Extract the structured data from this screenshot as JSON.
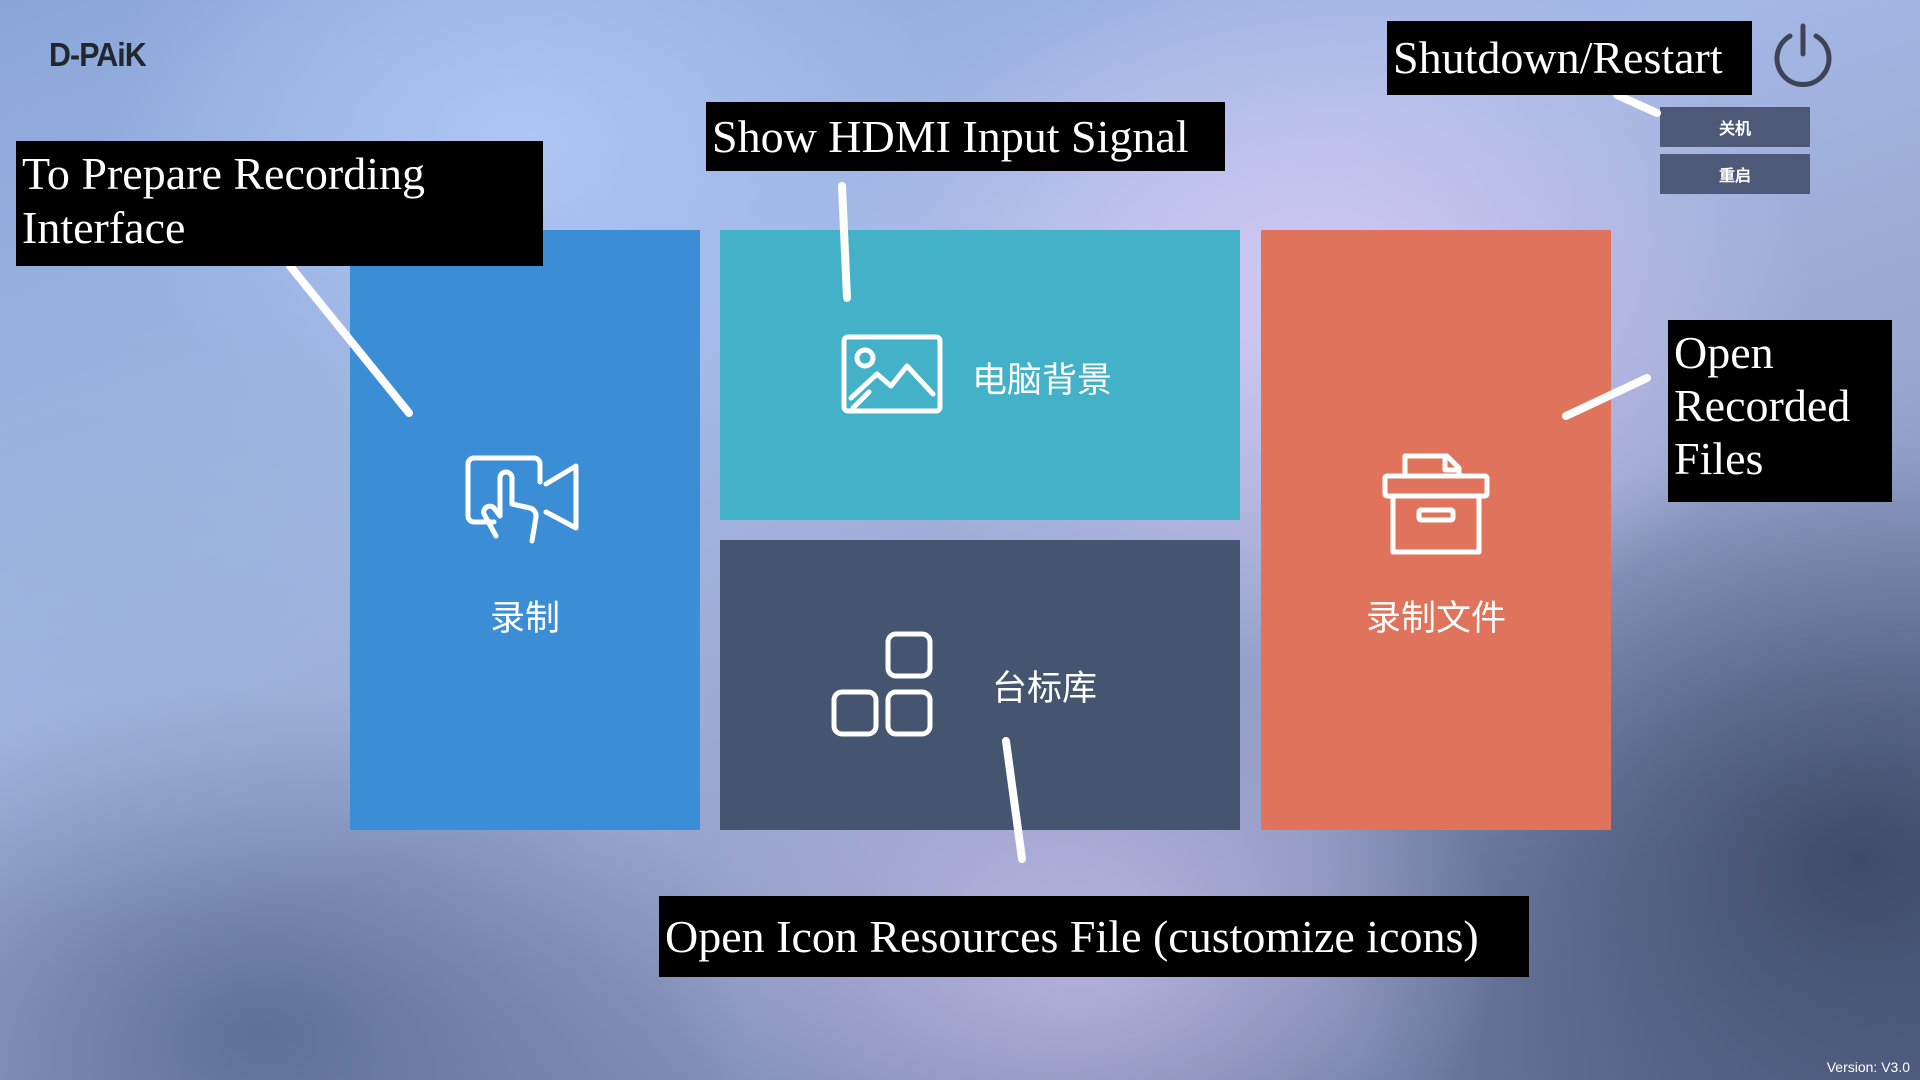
{
  "app": {
    "logo_text": "D-PAiK",
    "version": "Version: V3.0"
  },
  "tiles": {
    "record": {
      "label": "录制",
      "icon": "touch-camera-icon",
      "color": "#3b8ed6"
    },
    "background": {
      "label": "电脑背景",
      "icon": "image-icon",
      "color": "#43b1c8"
    },
    "station_logos": {
      "label": "台标库",
      "icon": "apps-grid-icon",
      "color": "#455570"
    },
    "recorded_files": {
      "label": "录制文件",
      "icon": "archive-box-icon",
      "color": "#e0735c"
    }
  },
  "power_menu": {
    "icon": "power-icon",
    "shutdown_label": "关机",
    "restart_label": "重启"
  },
  "callouts": {
    "record": "To Prepare Recording Interface",
    "hdmi": "Show HDMI Input Signal",
    "power": "Shutdown/Restart",
    "files": "Open Recorded Files",
    "icons": "Open Icon Resources File (customize icons)"
  }
}
